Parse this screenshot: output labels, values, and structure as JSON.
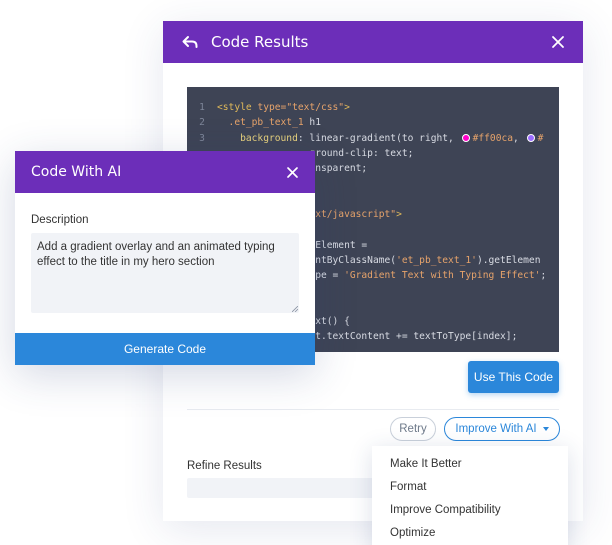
{
  "results_panel": {
    "title": "Code Results",
    "use_button": "Use This Code",
    "retry_button": "Retry",
    "improve_button": "Improve With AI",
    "refine_label": "Refine Results",
    "improve_menu": [
      "Make It Better",
      "Format",
      "Improve Compatibility",
      "Optimize"
    ]
  },
  "code": {
    "lines": [
      {
        "n": "1",
        "parts": [
          [
            "tag",
            "<style "
          ],
          [
            "attr",
            "type="
          ],
          [
            "str",
            "\"text/css\""
          ],
          [
            "tag",
            ">"
          ]
        ]
      },
      {
        "n": "2",
        "parts": [
          [
            "sel",
            "  .et_pb_text_1"
          ],
          [
            "plain",
            " h1"
          ]
        ]
      },
      {
        "n": "3",
        "parts": [
          [
            "prop",
            "    background"
          ],
          [
            "plain",
            ": linear-gradient(to right, "
          ],
          [
            "dot1",
            ""
          ],
          [
            "str",
            "#ff00ca"
          ],
          [
            "plain",
            ", "
          ],
          [
            "dot2",
            ""
          ],
          [
            "str",
            "#"
          ]
        ]
      },
      {
        "n": "",
        "parts": [
          [
            "plain",
            "                ground-clip: text;"
          ]
        ]
      },
      {
        "n": "",
        "parts": [
          [
            "plain",
            "                ansparent;"
          ]
        ]
      },
      {
        "n": "",
        "parts": [
          [
            "plain",
            ""
          ]
        ]
      },
      {
        "n": "",
        "parts": [
          [
            "plain",
            ""
          ]
        ]
      },
      {
        "n": "",
        "parts": [
          [
            "plain",
            "                "
          ],
          [
            "str",
            "ext/javascript\""
          ],
          [
            "tag",
            ">"
          ]
        ]
      },
      {
        "n": "",
        "parts": [
          [
            "plain",
            ""
          ]
        ]
      },
      {
        "n": "",
        "parts": [
          [
            "plain",
            "                tElement ="
          ]
        ]
      },
      {
        "n": "",
        "parts": [
          [
            "plain",
            "                entByClassName("
          ],
          [
            "str",
            "'et_pb_text_1'"
          ],
          [
            "plain",
            ").getElemen"
          ]
        ]
      },
      {
        "n": "",
        "parts": [
          [
            "plain",
            "                ype = "
          ],
          [
            "str",
            "'Gradient Text with Typing Effect'"
          ],
          [
            "plain",
            ";"
          ]
        ]
      },
      {
        "n": "",
        "parts": [
          [
            "plain",
            ""
          ]
        ]
      },
      {
        "n": "",
        "parts": [
          [
            "plain",
            ""
          ]
        ]
      },
      {
        "n": "",
        "parts": [
          [
            "plain",
            "                ext() {"
          ]
        ]
      },
      {
        "n": "",
        "parts": [
          [
            "plain",
            "                nt.textContent += textToType[index];"
          ]
        ]
      }
    ],
    "colors": {
      "dot1": "#ff00ca",
      "dot2": "#9b6cff"
    }
  },
  "ai_modal": {
    "title": "Code With AI",
    "description_label": "Description",
    "description_value": "Add a gradient overlay and an animated typing effect to the title in my hero section",
    "generate_button": "Generate Code"
  },
  "colors": {
    "header": "#6c2eb9",
    "primary": "#2b87da",
    "editor_bg": "#3e4455"
  }
}
